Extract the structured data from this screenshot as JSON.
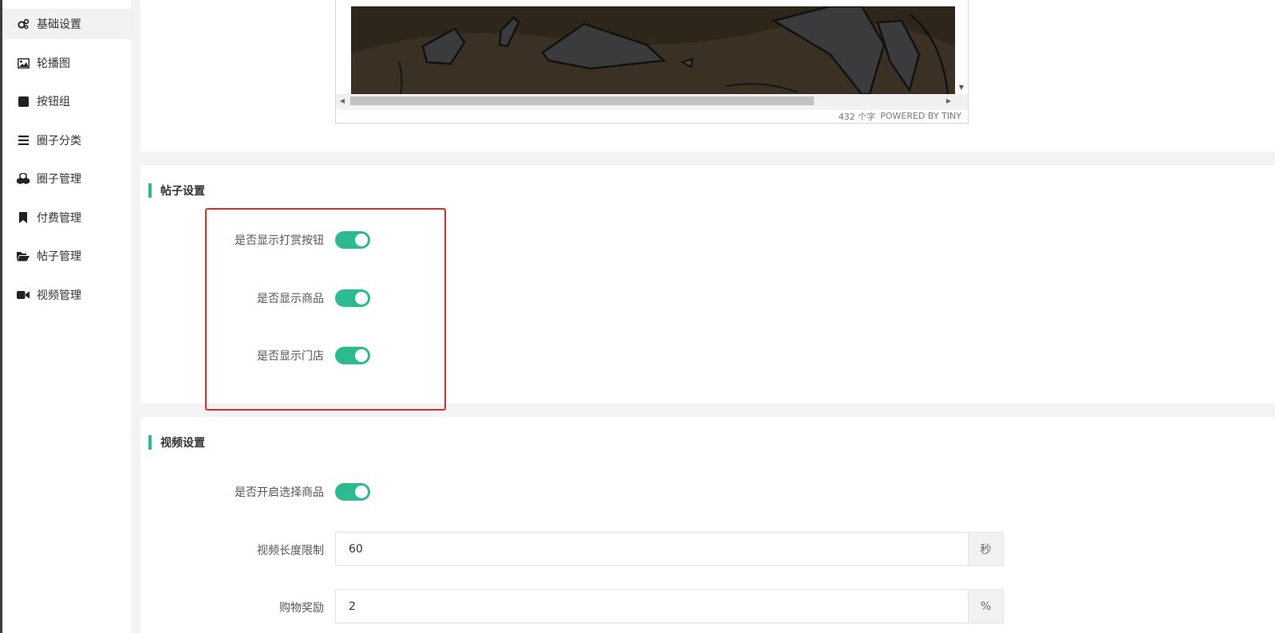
{
  "sidebar": {
    "items": [
      {
        "label": "基础设置",
        "icon": "gears-icon",
        "active": true
      },
      {
        "label": "轮播图",
        "icon": "image-icon"
      },
      {
        "label": "按钮组",
        "icon": "square-icon"
      },
      {
        "label": "圈子分类",
        "icon": "list-icon"
      },
      {
        "label": "圈子管理",
        "icon": "cubes-icon"
      },
      {
        "label": "付费管理",
        "icon": "bookmark-icon"
      },
      {
        "label": "帖子管理",
        "icon": "folder-open-icon"
      },
      {
        "label": "视频管理",
        "icon": "video-camera-icon"
      }
    ]
  },
  "editor": {
    "word_count": "432 个字",
    "powered_by": "POWERED BY TINY"
  },
  "post_settings": {
    "title": "帖子设置",
    "switches": [
      {
        "label": "是否显示打赏按钮",
        "on": true
      },
      {
        "label": "是否显示商品",
        "on": true
      },
      {
        "label": "是否显示门店",
        "on": true
      }
    ]
  },
  "video_settings": {
    "title": "视频设置",
    "switch_label": "是否开启选择商品",
    "switch_on": true,
    "length_label": "视频长度限制",
    "length_value": "60",
    "length_unit": "秒",
    "reward_label": "购物奖励",
    "reward_value": "2",
    "reward_unit": "%"
  },
  "colors": {
    "accent": "#2dba93",
    "highlight": "#e02b2b"
  }
}
